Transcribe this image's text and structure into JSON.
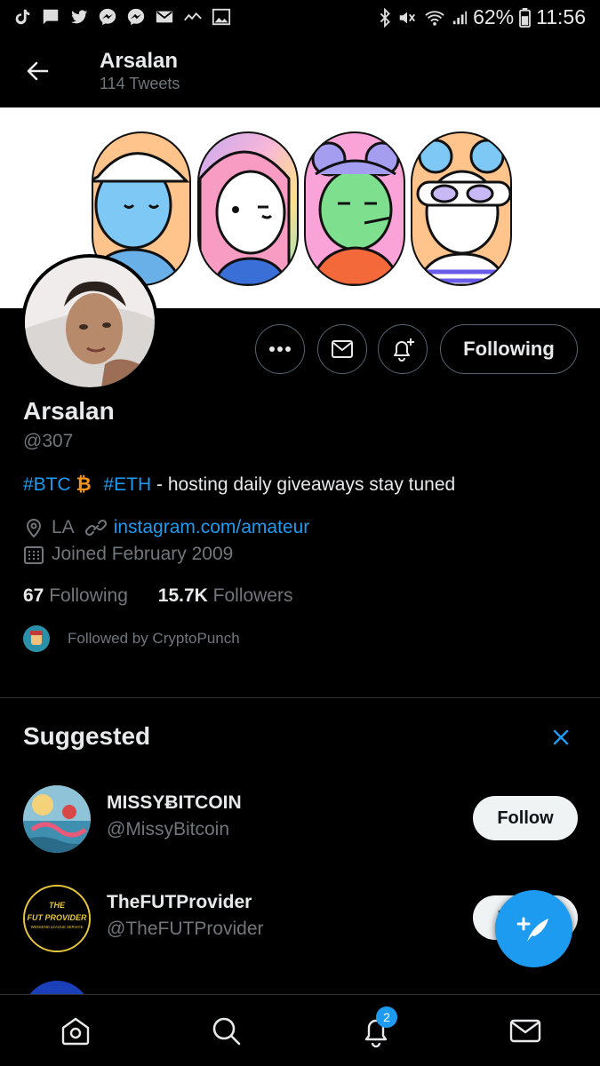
{
  "status_bar": {
    "battery": "62%",
    "time": "11:56"
  },
  "header": {
    "title": "Arsalan",
    "subtitle": "114 Tweets"
  },
  "profile": {
    "name": "Arsalan",
    "handle": "@307",
    "bio": {
      "tag1": "#BTC",
      "btc_symbol": "₿",
      "tag2": "#ETH",
      "text": " - hosting daily giveaways stay tuned"
    },
    "location": "LA",
    "website": "instagram.com/amateur",
    "joined": "Joined February 2009",
    "following_count": "67",
    "following_label": "Following",
    "followers_count": "15.7K",
    "followers_label": "Followers",
    "followed_by": "Followed by CryptoPunch",
    "following_button": "Following"
  },
  "suggested": {
    "title": "Suggested",
    "accounts": [
      {
        "name": "MISSYɃITCOIN",
        "handle": "@MissyBitcoin",
        "button": "Follow"
      },
      {
        "name": "TheFUTProvider",
        "handle": "@TheFUTProvider",
        "button": "Follow",
        "avatar_text1": "THE",
        "avatar_text2": "FUT PROVIDER",
        "avatar_text3": "WEEKEND LEAGUE SERVICE"
      }
    ]
  },
  "bottom_nav": {
    "notifications_badge": "2"
  },
  "colors": {
    "accent": "#1d9bf0",
    "background": "#000000",
    "muted": "#71767b",
    "btc": "#f7931a"
  }
}
